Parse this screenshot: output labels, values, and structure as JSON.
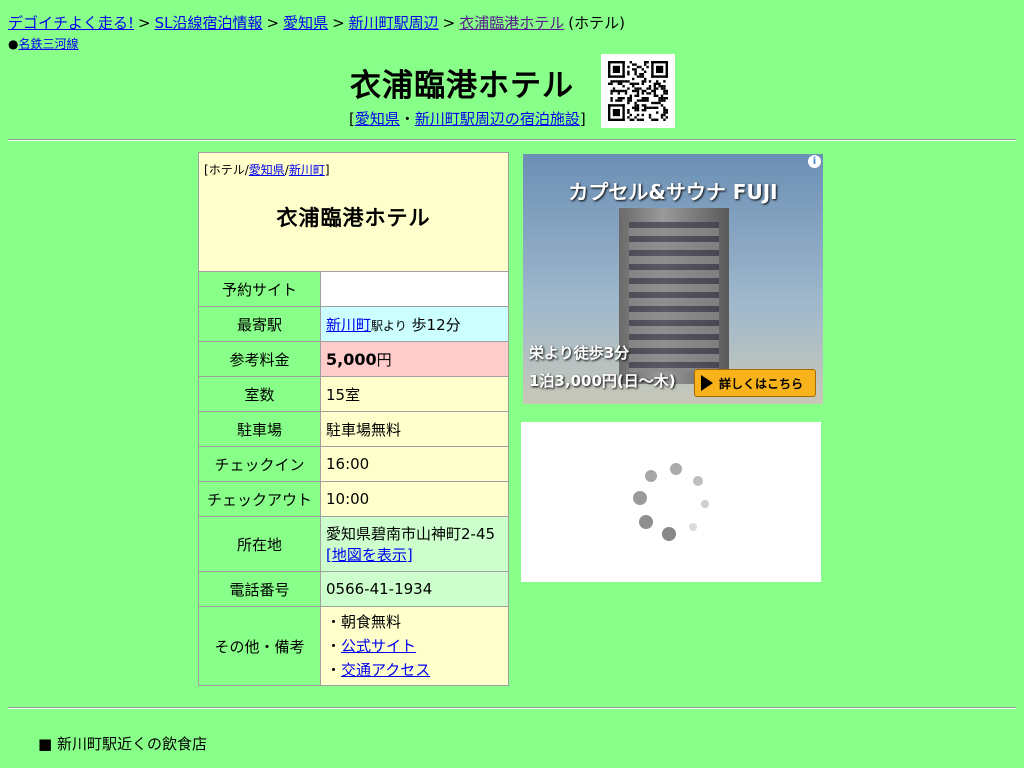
{
  "breadcrumb": {
    "items": [
      {
        "label": "デゴイチよく走る!",
        "link": true
      },
      {
        "label": "SL沿線宿泊情報",
        "link": true
      },
      {
        "label": "愛知県",
        "link": true
      },
      {
        "label": "新川町駅周辺",
        "link": true
      },
      {
        "label": "衣浦臨港ホテル",
        "link": true,
        "visited": true
      },
      {
        "label": "(ホテル)",
        "link": false
      }
    ],
    "separator": ">"
  },
  "line_link": {
    "bullet": "●",
    "label": "名鉄三河線"
  },
  "header": {
    "title": "衣浦臨港ホテル",
    "subnav": {
      "open": "[",
      "pref": "愛知県",
      "dot": "・",
      "area": "新川町駅周辺の宿泊施設",
      "close": "]"
    }
  },
  "info_table": {
    "category": {
      "open": "[",
      "type": "ホテル",
      "slash1": "/",
      "pref": "愛知県",
      "slash2": "/",
      "town": "新川町",
      "close": "]"
    },
    "hotel_name": "衣浦臨港ホテル",
    "rows": {
      "booking": {
        "label": "予約サイト",
        "value": ""
      },
      "station": {
        "label": "最寄駅",
        "station_link": "新川町",
        "suffix_small": "駅より",
        "walk": " 歩12分"
      },
      "price": {
        "label": "参考料金",
        "amount": "5,000",
        "unit": "円"
      },
      "rooms": {
        "label": "室数",
        "value": "15室"
      },
      "parking": {
        "label": "駐車場",
        "value": "駐車場無料"
      },
      "checkin": {
        "label": "チェックイン",
        "value": "16:00"
      },
      "checkout": {
        "label": "チェックアウト",
        "value": "10:00"
      },
      "address": {
        "label": "所在地",
        "value": "愛知県碧南市山神町2-45",
        "map_open": "[",
        "map_link": "地図を表示",
        "map_close": "]"
      },
      "phone": {
        "label": "電話番号",
        "value": "0566-41-1934"
      },
      "notes": {
        "label": "その他・備考",
        "bullet": "・",
        "items": [
          "朝食無料",
          "公式サイト",
          "交通アクセス"
        ]
      }
    }
  },
  "ad": {
    "title": "カプセル&サウナ FUJI",
    "line1": "栄より徒歩3分",
    "line2": "1泊3,000円(日～木)",
    "button": "詳しくはこちら",
    "info_icon": "i"
  },
  "footer": {
    "bullet": "■",
    "heading": "新川町駅近くの飲食店"
  },
  "colors": {
    "background": "#88ff88",
    "link": "#0000ee",
    "header_cell": "#ffffcc",
    "price_cell": "#ffcccc",
    "station_cell": "#ccffff"
  }
}
